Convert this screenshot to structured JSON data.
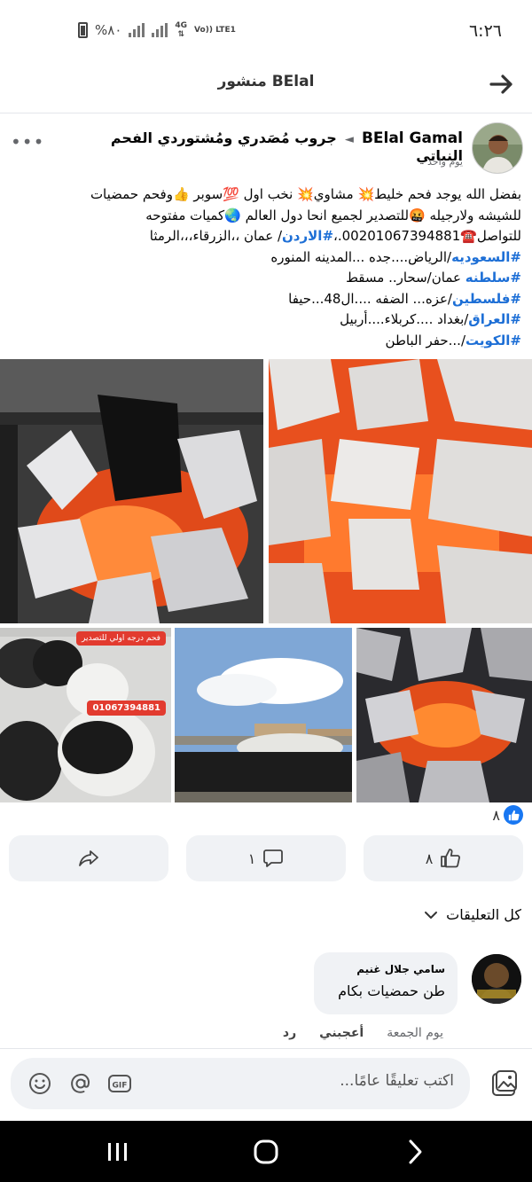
{
  "status_bar": {
    "time": "٦:٢٦",
    "battery": "%٨٠",
    "network_1": "4G",
    "network_2": "Vo)) LTE1"
  },
  "header": {
    "title": "منشور BElal"
  },
  "post": {
    "author": "BElal Gamal",
    "group": "جروب مُصَدري ومُشتوردي الفحم النباتي",
    "time": "يوم واحد",
    "lines": [
      "بفضل الله يوجد فحم خليط💥 مشاوي💥 نخب اول 💯سوبر 👍وفحم حمضيات",
      "للشيشه ولارجيله 🤬للتصدير لجميع انحا دول العالم 🌏كميات مفتوحه",
      "للتواصل☎️00201067394881.،",
      "/الرياض....جده ...المدينه المنوره",
      "عمان/سحار..  مسقط",
      "/عزه... الضفه ....ال48...حيفا",
      "/بغداد ....كربلاء....أربيل",
      "/...حفر الباطن"
    ],
    "line3_tag": "#الاردن",
    "line3_rest": "/ عمان ،،الزرقاء،،،الرمثا",
    "tags": {
      "saudi": "#السعوديه",
      "oman": "#سلطنه",
      "palestine": "#فلسطين",
      "iraq": "#العراق",
      "kuwait": "#الكويت"
    },
    "photo_badge": "فحم درجه اولي للتصدير",
    "photo_phone": "01067394881",
    "reactions_count": "٨"
  },
  "actions": {
    "like_count": "٨",
    "comment_count": "١"
  },
  "comments": {
    "filter_label": "كل التعليقات",
    "items": [
      {
        "name": "سامي جلال غنيم",
        "text": "طن حمضيات بكام",
        "time": "يوم الجمعة",
        "like": "أعجبني",
        "reply": "رد"
      }
    ]
  },
  "composer": {
    "placeholder": "اكتب تعليقًا عامًا..."
  },
  "colors": {
    "accent": "#1877f2",
    "hashtag": "#1d6fd6",
    "button_bg": "#f0f2f5",
    "badge_red": "#e23b2f"
  }
}
